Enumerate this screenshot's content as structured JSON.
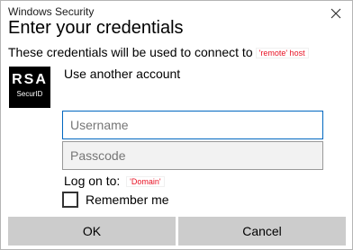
{
  "window": {
    "title": "Windows Security"
  },
  "dialog": {
    "heading": "Enter your credentials",
    "description": "These credentials will be used to connect to",
    "host": "'remote' host",
    "account_option": "Use another account"
  },
  "logo": {
    "brand": "RSA",
    "subtitle": "SecurID"
  },
  "fields": {
    "username_placeholder": "Username",
    "passcode_placeholder": "Passcode"
  },
  "logon": {
    "label": "Log on to:",
    "domain": "'Domain'"
  },
  "remember": {
    "label": "Remember me",
    "checked": false
  },
  "buttons": {
    "ok": "OK",
    "cancel": "Cancel"
  }
}
